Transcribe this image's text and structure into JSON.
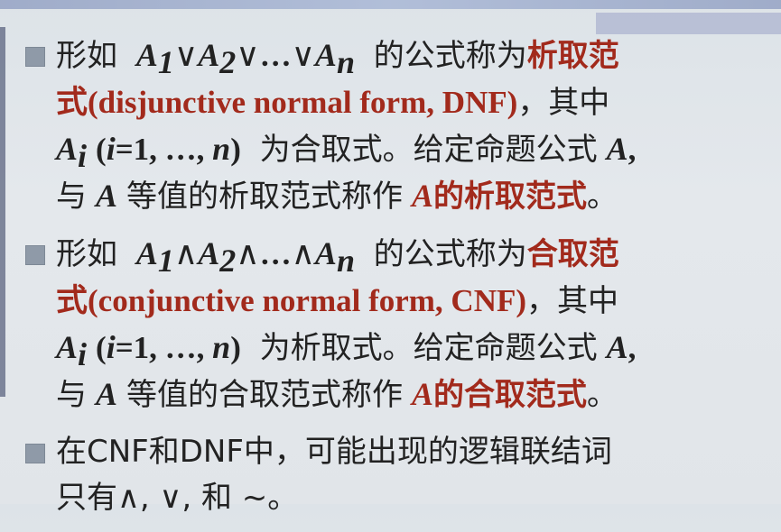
{
  "items": [
    {
      "l1_pre": "形如",
      "a1": "A",
      "s1": "1",
      "or1": "∨",
      "a2": "A",
      "s2": "2",
      "or2": "∨",
      "dots": "…",
      "or3": "∨",
      "an": "A",
      "sn": "n",
      "l1_mid": "的公式称为",
      "l1_term": "析取范",
      "l2_term": "式(disjunctive normal form, DNF)",
      "l2_rest": "，其中",
      "l3_ai": "A",
      "l3_i": "i",
      "l3_paren": "(",
      "l3_i2": "i",
      "l3_eq": "=1, …, ",
      "l3_n": "n",
      "l3_close": ")",
      "l3_rest": "为合取式。给定命题公式",
      "l3_A": "A",
      "l3_comma": ",",
      "l4_pre": "与",
      "l4_A": "A",
      "l4_mid": "等值的析取范式称作",
      "l4_A2": "A",
      "l4_term": "的析取范式",
      "l4_end": "。"
    },
    {
      "l1_pre": "形如",
      "a1": "A",
      "s1": "1",
      "or1": "∧",
      "a2": "A",
      "s2": "2",
      "or2": "∧",
      "dots": "…",
      "or3": "∧",
      "an": "A",
      "sn": "n",
      "l1_mid": "的公式称为",
      "l1_term": "合取范",
      "l2_term": "式(conjunctive normal form, CNF)",
      "l2_rest": "，其中",
      "l3_ai": "A",
      "l3_i": "i",
      "l3_paren": "(",
      "l3_i2": "i",
      "l3_eq": "=1, …, ",
      "l3_n": "n",
      "l3_close": ")",
      "l3_rest": "为析取式。给定命题公式",
      "l3_A": "A",
      "l3_comma": ",",
      "l4_pre": "与",
      "l4_A": "A",
      "l4_mid": "等值的合取范式称作",
      "l4_A2": "A",
      "l4_term": "的合取范式",
      "l4_end": "。"
    }
  ],
  "third": {
    "line1": "在CNF和DNF中，可能出现的逻辑联结词",
    "line2": "只有∧, ∨, 和 ~。"
  },
  "colors": {
    "term": "#a22a1c",
    "bullet": "#8f9aa8",
    "background": "#e2e6ea"
  }
}
